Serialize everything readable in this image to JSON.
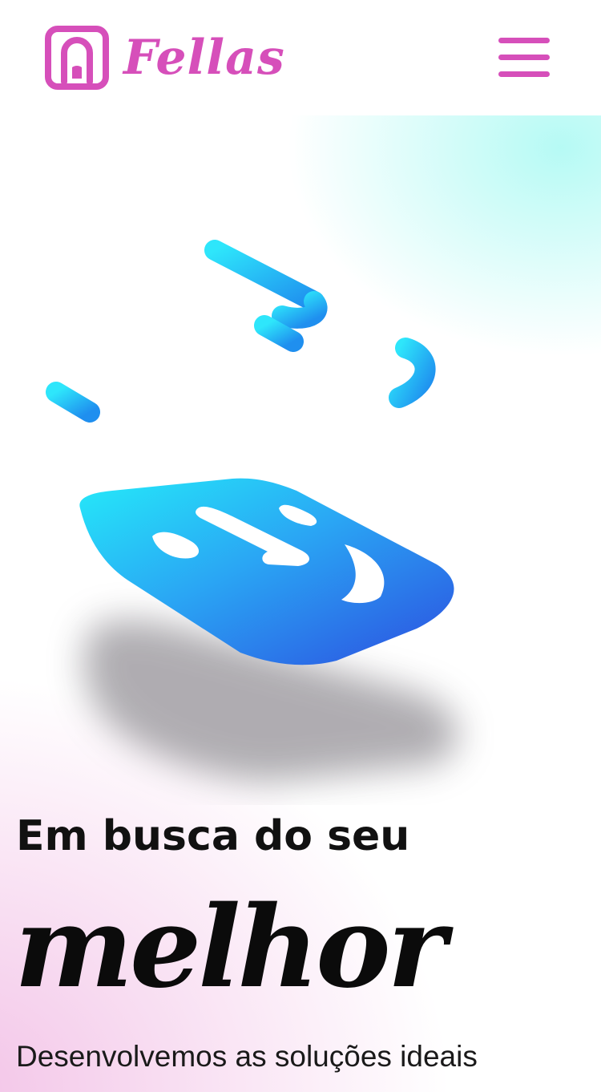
{
  "header": {
    "brand_name": "Fellas",
    "menu_icon": "hamburger-menu-icon",
    "brand_color": "#d64fba"
  },
  "hero": {
    "headline": "Em busca do seu",
    "highlight": "melhor",
    "subtitle": "Desenvolvemos as soluções ideais"
  }
}
